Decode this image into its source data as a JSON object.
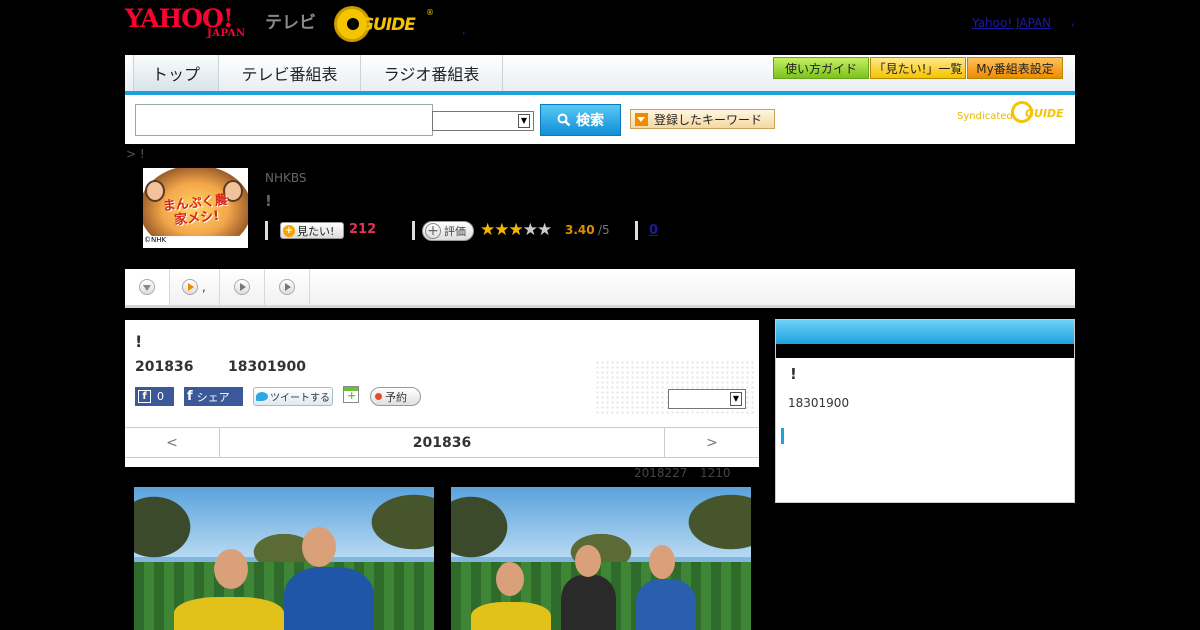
{
  "header": {
    "yahoo_logo_line1": "YAHOO!",
    "yahoo_logo_line2": "JAPAN",
    "tv_label": "テレビ",
    "gguide_logo": "GUIDE",
    "gguide_reg": "®",
    "yahoo_japan_link": "Yahoo! JAPAN",
    "dot": ",",
    "dot2": ","
  },
  "nav": {
    "tabs": [
      "トップ",
      "テレビ番組表",
      "ラジオ番組表"
    ],
    "buttons": {
      "guide": "使い方ガイド",
      "mitai_list": "「見たい!」一覧",
      "my_schedule": "My番組表設定"
    }
  },
  "search": {
    "input_value": "",
    "select_value": "",
    "button_label": "検索",
    "keyword_button": "登録したキーワード",
    "syndicated": "Syndicated",
    "syndicated_logo": "GUIDE"
  },
  "breadcrumb": "> !",
  "program": {
    "thumb_title": "まんぷく農家メシ!",
    "thumb_credit": "©NHK",
    "channel": "NHKBS",
    "title": "!",
    "mitai_label": "見たい!",
    "mitai_count": "212",
    "rate_label": "評価",
    "rating": 3.4,
    "rating_value": "3.40",
    "rating_max": "/5",
    "review_count": "0"
  },
  "tabstrip": {
    "tab2_label": ","
  },
  "detail": {
    "title": "!",
    "date": "201836",
    "time": "18301900",
    "like_count": "0",
    "share_label": "シェア",
    "tweet_label": "ツイートする",
    "reserve_label": "予約",
    "select_value": "",
    "prev": "<",
    "next": ">",
    "nav_date": "201836"
  },
  "updated": {
    "date": "2018227",
    "time": "1210"
  },
  "side": {
    "title": "!",
    "time": "18301900"
  },
  "icons": {
    "search": "search-icon",
    "star": "star-icon",
    "play": "play-icon",
    "calendar_add": "calendar-add-icon"
  },
  "colors": {
    "accent_blue": "#1ea0dc",
    "mitai_count": "#e6315a",
    "rating": "#e38e00",
    "yahoo_red": "#ff0033",
    "gguide_yellow": "#f5c400"
  }
}
